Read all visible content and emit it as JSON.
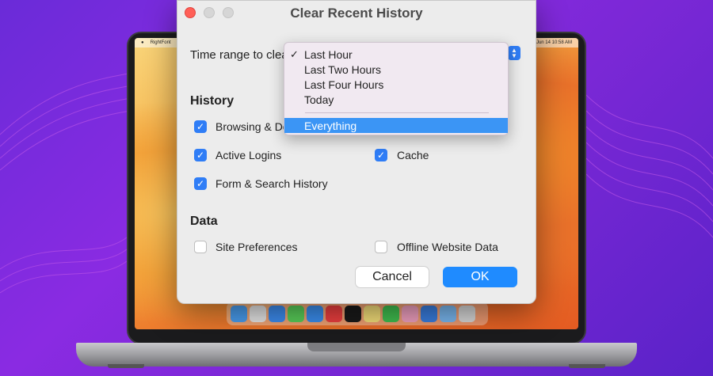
{
  "dialog": {
    "title": "Clear Recent History",
    "time_range_label": "Time range to clear:",
    "history_heading": "History",
    "data_heading": "Data",
    "cancel_label": "Cancel",
    "ok_label": "OK"
  },
  "dropdown": {
    "items": [
      {
        "label": "Last Hour",
        "checked": true
      },
      {
        "label": "Last Two Hours"
      },
      {
        "label": "Last Four Hours"
      },
      {
        "label": "Today"
      },
      {
        "label": "Everything",
        "highlighted": true
      }
    ]
  },
  "history_options": [
    {
      "label": "Browsing & Download History",
      "checked": true
    },
    {
      "label": "Active Logins",
      "checked": true
    },
    {
      "label": "Cache",
      "checked": true
    },
    {
      "label": "Form & Search History",
      "checked": true
    }
  ],
  "data_options": [
    {
      "label": "Site Preferences",
      "checked": false
    },
    {
      "label": "Offline Website Data",
      "checked": false
    }
  ],
  "menubar": {
    "app": "RightFont",
    "clock": "Wed Jun 14  10:58 AM"
  },
  "colors": {
    "accent": "#2f7df6",
    "ok_button": "#1f8bff",
    "close_button": "#ff5f57",
    "menu_highlight": "#3b95f5"
  }
}
